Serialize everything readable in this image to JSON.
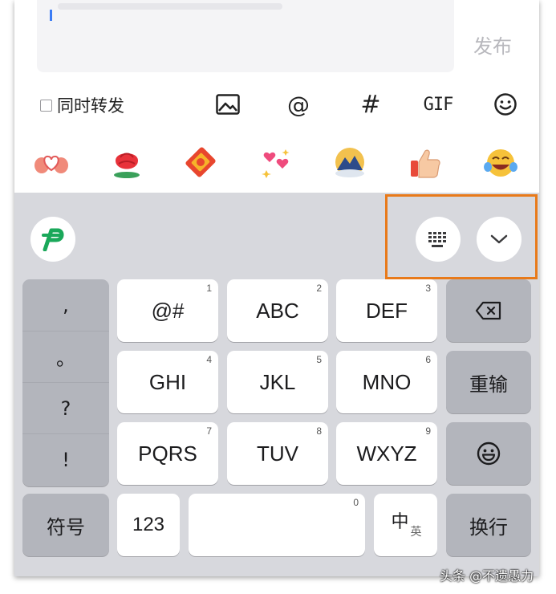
{
  "compose": {
    "publish_label": "发布"
  },
  "toolbar": {
    "repost_label": "同时转发",
    "at_label": "@",
    "hash_label": "#",
    "gif_label": "GIF"
  },
  "stickers": [
    "heart-hands-sticker",
    "rose-sticker",
    "red-envelope-sticker",
    "sparkles-hearts-sticker",
    "mountain-sticker",
    "thumbs-up-sticker",
    "laughing-crying-sticker"
  ],
  "keyboard": {
    "punctuation": [
      ",",
      "。",
      "?",
      "!"
    ],
    "keys": [
      {
        "label": "@#",
        "num": "1"
      },
      {
        "label": "ABC",
        "num": "2"
      },
      {
        "label": "DEF",
        "num": "3"
      },
      {
        "label": "GHI",
        "num": "4"
      },
      {
        "label": "JKL",
        "num": "5"
      },
      {
        "label": "MNO",
        "num": "6"
      },
      {
        "label": "PQRS",
        "num": "7"
      },
      {
        "label": "TUV",
        "num": "8"
      },
      {
        "label": "WXYZ",
        "num": "9"
      }
    ],
    "retype_label": "重输",
    "symbols_label": "符号",
    "numbers_label": "123",
    "space_num": "0",
    "lang_main": "中",
    "lang_sub": "英",
    "return_label": "换行"
  },
  "colors": {
    "highlight": "#e87a1a",
    "logo_green": "#1aa85a",
    "keyboard_bg": "#d7d8dd"
  },
  "watermark": "头条 @不遗愚力"
}
